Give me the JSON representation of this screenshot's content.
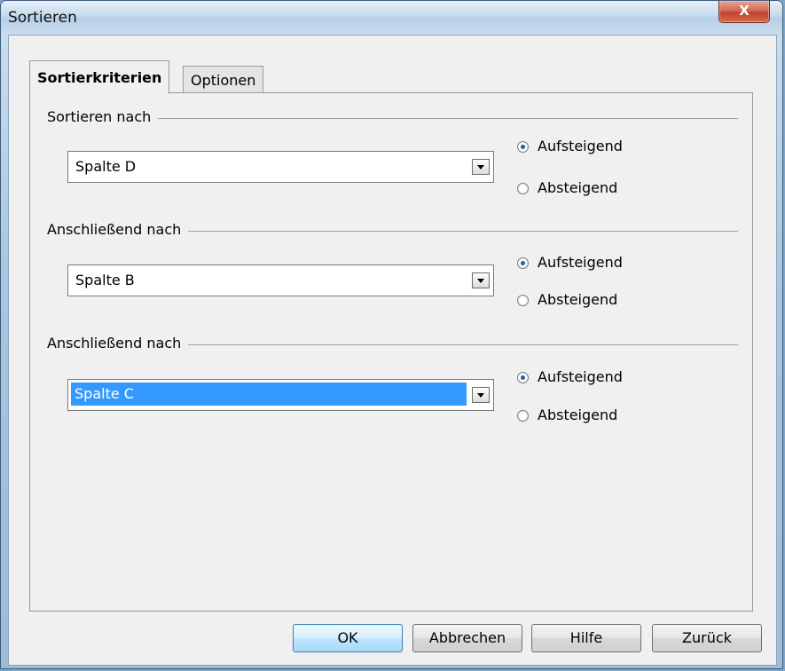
{
  "window": {
    "title": "Sortieren",
    "close_label": "X"
  },
  "tabs": [
    {
      "label": "Sortierkriterien",
      "active": true
    },
    {
      "label": "Optionen",
      "active": false
    }
  ],
  "groups": [
    {
      "heading": "Sortieren nach",
      "selected": "Spalte D",
      "focused": false,
      "ascending": "Aufsteigend",
      "descending": "Absteigend",
      "order": "ascending"
    },
    {
      "heading": "Anschließend nach",
      "selected": "Spalte B",
      "focused": false,
      "ascending": "Aufsteigend",
      "descending": "Absteigend",
      "order": "ascending"
    },
    {
      "heading": "Anschließend nach",
      "selected": "Spalte C",
      "focused": true,
      "ascending": "Aufsteigend",
      "descending": "Absteigend",
      "order": "ascending"
    }
  ],
  "buttons": {
    "ok": "OK",
    "cancel": "Abbrechen",
    "help": "Hilfe",
    "back": "Zurück"
  },
  "colors": {
    "selection": "#3399ff",
    "default_button_border": "#3c7fb1",
    "close_button": "#c0422c"
  }
}
